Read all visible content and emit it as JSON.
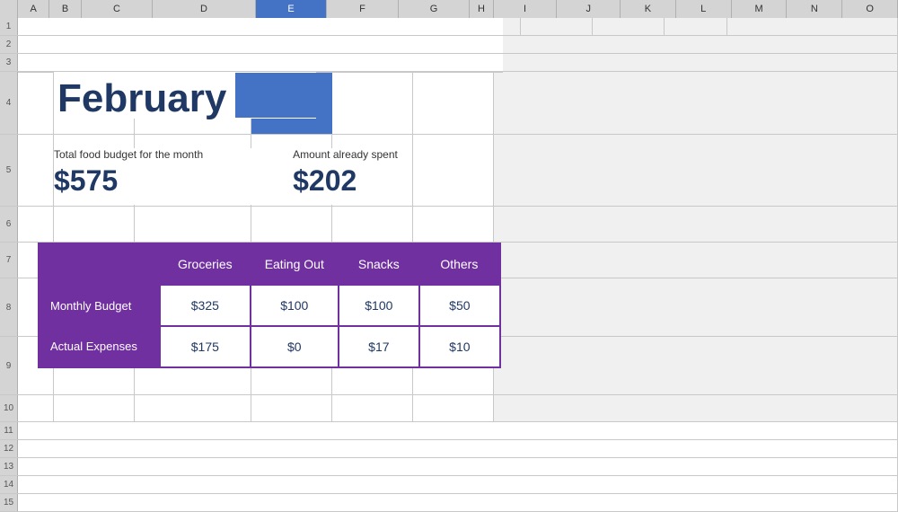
{
  "header": {
    "month": "February",
    "col_headers": [
      "A",
      "B",
      "C",
      "D",
      "E",
      "F",
      "G",
      "H",
      "I",
      "J",
      "K",
      "L",
      "M",
      "N",
      "O"
    ],
    "row_numbers": [
      "1",
      "2",
      "3",
      "4",
      "5",
      "6",
      "7",
      "8",
      "9",
      "10",
      "11",
      "12",
      "13",
      "14",
      "15"
    ]
  },
  "budget_summary": {
    "total_food_label": "Total food budget for the month",
    "total_food_value": "$575",
    "amount_spent_label": "Amount already spent",
    "amount_spent_value": "$202"
  },
  "table": {
    "headers": [
      "",
      "Groceries",
      "Eating Out",
      "Snacks",
      "Others"
    ],
    "rows": [
      {
        "label": "Monthly Budget",
        "values": [
          "$325",
          "$100",
          "$100",
          "$50"
        ]
      },
      {
        "label": "Actual Expenses",
        "values": [
          "$175",
          "$0",
          "$17",
          "$10"
        ]
      }
    ]
  },
  "colors": {
    "purple": "#7030a0",
    "dark_blue": "#1f3864",
    "blue_rect": "#4472c4",
    "white": "#ffffff",
    "light_gray": "#f0f0f0",
    "grid_line": "#c8c8c8"
  }
}
